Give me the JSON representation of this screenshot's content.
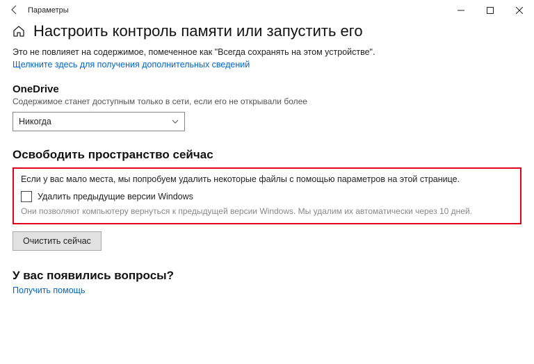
{
  "titlebar": {
    "title": "Параметры"
  },
  "header": {
    "title": "Настроить контроль памяти или запустить его"
  },
  "info": {
    "text": "Это не повлияет на содержимое, помеченное как \"Всегда сохранять на этом устройстве\".",
    "link": "Щелкните здесь для получения дополнительных сведений"
  },
  "onedrive": {
    "title": "OneDrive",
    "desc": "Содержимое станет доступным только в сети, если его не открывали более",
    "dropdown_value": "Никогда"
  },
  "freespace": {
    "title": "Освободить пространство сейчас",
    "text": "Если у вас мало места, мы попробуем удалить некоторые файлы с помощью параметров на этой странице.",
    "checkbox_label": "Удалить предыдущие версии Windows",
    "sub": "Они позволяют компьютеру вернуться к предыдущей версии Windows. Мы удалим их автоматически через 10 дней.",
    "button": "Очистить сейчас"
  },
  "questions": {
    "title": "У вас появились вопросы?",
    "link": "Получить помощь"
  }
}
